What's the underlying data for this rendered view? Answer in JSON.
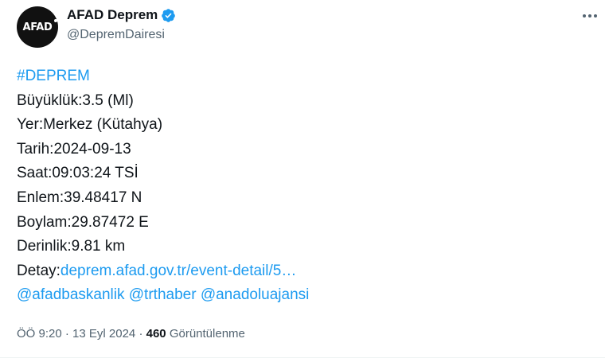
{
  "account": {
    "avatar_text": "AFAD",
    "display_name": "AFAD Deprem",
    "handle": "@DepremDairesi",
    "verified": true
  },
  "tweet": {
    "hashtag": "#DEPREM",
    "magnitude": "Büyüklük:3.5 (Ml)",
    "location": "Yer:Merkez (Kütahya)",
    "date": "Tarih:2024-09-13",
    "time": "Saat:09:03:24 TSİ",
    "latitude": "Enlem:39.48417 N",
    "longitude": "Boylam:29.87472 E",
    "depth": "Derinlik:9.81 km",
    "detail_label": "Detay:",
    "detail_link": "deprem.afad.gov.tr/event-detail/5…",
    "mentions": [
      "@afadbaskanlik",
      "@trthaber",
      "@anadoluajansi"
    ]
  },
  "meta": {
    "time": "ÖÖ 9:20",
    "separator": "·",
    "date": "13 Eyl 2024",
    "views_count": "460",
    "views_label": "Görüntülenme"
  },
  "colors": {
    "text": "#0f1419",
    "secondary": "#536471",
    "link": "#1d9bf0",
    "avatar_bg": "#111111"
  }
}
